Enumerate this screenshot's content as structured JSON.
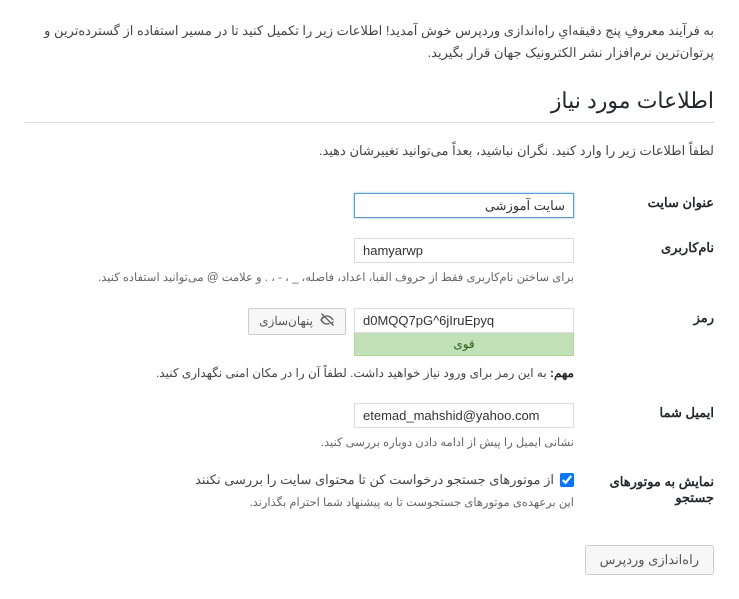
{
  "intro": "به فرآیند معروفِ پنج دقیقه‌ایِ راه‌اندازی وردپرس خوش آمدید! اطلاعات زیر را تکمیل کنید تا در مسیر استفاده از گسترده‌ترین و پرتوان‌ترین نرم‌افزار نشر الکترونیک جهان قرار بگیرید.",
  "heading": "اطلاعات مورد نیاز",
  "desc": "لطفاً اطلاعات زیر را وارد کنید. نگران نباشید، بعداً می‌توانید تغییرشان دهید.",
  "fields": {
    "site_title": {
      "label": "عنوان سایت",
      "value": "سایت آموزشی"
    },
    "username": {
      "label": "نام‌کاربری",
      "value": "hamyarwp",
      "hint": "برای ساختن نام‌کاربری فقط از حروف الفبا، اعداد، فاصله، _ ، - ، . و علامت @ می‌توانید استفاده کنید."
    },
    "password": {
      "label": "رمز",
      "value": "d0MQQ7pG^6jIruEpyq",
      "strength": "قوی",
      "hide_btn": "پنهان‌سازی",
      "note_strong": "مهم:",
      "note_text": " به این رمز برای ورود نیاز خواهید داشت. لطفاً آن را در مکان امنی نگهداری کنید."
    },
    "email": {
      "label": "ایمیل شما",
      "value": "etemad_mahshid@yahoo.com",
      "hint": "نشانی ایمیل را پیش از ادامه دادن دوباره بررسی کنید."
    },
    "search_engines": {
      "label": "نمایش به موتورهای جستجو",
      "checkbox_label": "از موتورهای جستجو درخواست کن تا محتوای سایت را بررسی نکنند",
      "hint": "این برعهده‌ی موتورهای جستجوست تا به پیشنهاد شما احترام بگذارند."
    }
  },
  "submit": "راه‌اندازی وردپرس"
}
